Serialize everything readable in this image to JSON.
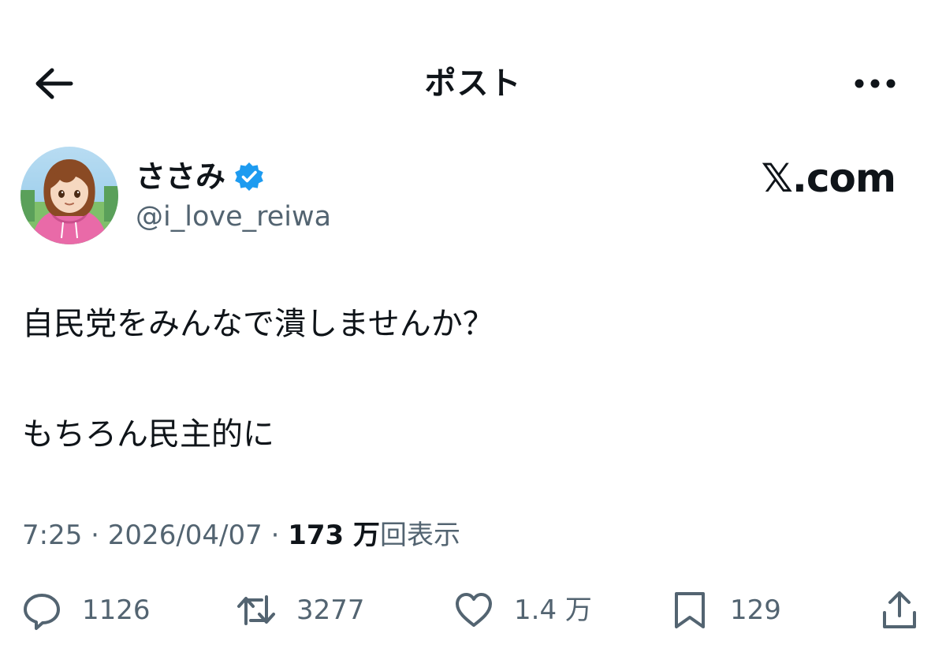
{
  "header": {
    "title": "ポスト",
    "back_icon": "arrow-left-icon",
    "more_icon": "ellipsis-icon"
  },
  "author": {
    "display_name": "ささみ",
    "handle": "@i_love_reiwa",
    "verified": true,
    "verified_color": "#1d9bf0"
  },
  "brand": {
    "text": "𝕏.com"
  },
  "tweet": {
    "lines": [
      "自民党をみんなで潰しませんか？",
      "もちろん民主的に"
    ]
  },
  "meta": {
    "time": "7:25",
    "separator": "·",
    "date": "2026/04/07",
    "views_count": "173 万",
    "views_label": "回表示"
  },
  "actions": {
    "reply_count": "1126",
    "retweet_count": "3277",
    "like_count": "1.4 万",
    "bookmark_count": "129"
  },
  "colors": {
    "text_primary": "#0f1419",
    "text_secondary": "#536471",
    "verified_blue": "#1d9bf0",
    "avatar_hoodie": "#e96aa8"
  }
}
